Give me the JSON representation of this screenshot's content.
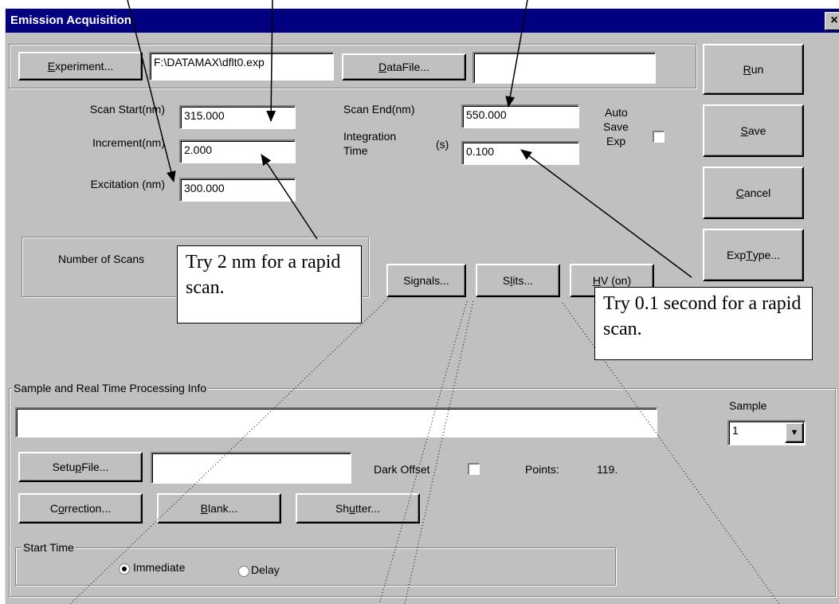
{
  "window": {
    "title": "Emission Acquisition",
    "close_glyph": "×"
  },
  "top": {
    "experiment_button": {
      "pre": "",
      "u": "E",
      "post": "xperiment..."
    },
    "experiment_path": "F:\\DATAMAX\\dflt0.exp",
    "datafile_button": {
      "pre": "",
      "u": "D",
      "post": "ataFile..."
    },
    "datafile_value": ""
  },
  "side_buttons": {
    "run": {
      "pre": "",
      "u": "R",
      "post": "un"
    },
    "save": {
      "pre": "",
      "u": "S",
      "post": "ave"
    },
    "cancel": {
      "pre": "",
      "u": "C",
      "post": "ancel"
    },
    "exp_type": {
      "pre": "Exp ",
      "u": "T",
      "post": "ype..."
    }
  },
  "params": {
    "scan_start_label": "Scan Start(nm)",
    "scan_start_value": "315.000",
    "increment_label": "Increment(nm)",
    "increment_value": "2.000",
    "excitation_label": "Excitation (nm)",
    "excitation_value": "300.000",
    "scan_end_label": "Scan End(nm)",
    "scan_end_value": "550.000",
    "integration_label_1": "Integration",
    "integration_label_2": "Time",
    "integration_unit": "(s)",
    "integration_value": "0.100",
    "auto_save_1": "Auto",
    "auto_save_2": "Save",
    "auto_save_3": "Exp",
    "auto_save_checked": false
  },
  "scans": {
    "label": "Number of Scans"
  },
  "mid_buttons": {
    "signals": {
      "pre": "Si",
      "u": "g",
      "post": "nals..."
    },
    "slits": {
      "pre": "S",
      "u": "l",
      "post": "its..."
    },
    "hv": {
      "pre": "",
      "u": "H",
      "post": "V (on)"
    }
  },
  "callouts": {
    "increment_tip": "Try 2 nm for a rapid scan.",
    "integration_tip": "Try 0.1 second for a rapid scan."
  },
  "sample_group": {
    "title": "Sample and Real Time Processing Info",
    "info_value": "",
    "sample_label": "Sample",
    "sample_value": "1",
    "setup_button": {
      "pre": "Setu",
      "u": "p",
      "post": " File..."
    },
    "setup_value": "",
    "dark_offset_label": "Dark Offset",
    "dark_offset_checked": false,
    "points_label": "Points:",
    "points_value": "119.",
    "correction_button": {
      "pre": "C",
      "u": "o",
      "post": "rrection..."
    },
    "blank_button": {
      "pre": "",
      "u": "B",
      "post": "lank..."
    },
    "shutter_button": {
      "pre": "Sh",
      "u": "u",
      "post": "tter..."
    }
  },
  "start_time": {
    "title": "Start Time",
    "immediate_label": "Immediate",
    "delay_label": "Delay",
    "selected": "Immediate"
  }
}
